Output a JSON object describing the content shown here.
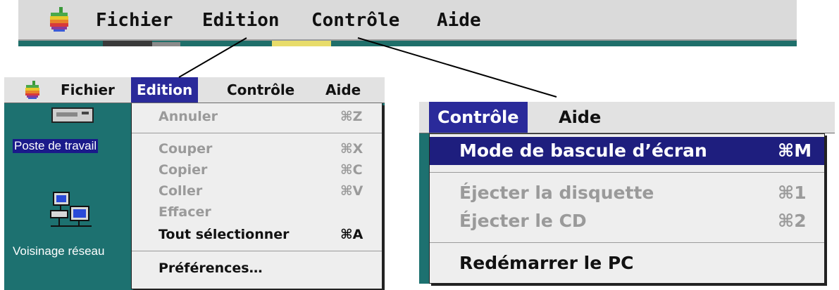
{
  "top_menubar": {
    "apple_icon": "apple-rainbow-icon",
    "items": [
      "Fichier",
      "Edition",
      "Contrôle",
      "Aide"
    ]
  },
  "edition_panel": {
    "menubar_items": [
      "Fichier",
      "Edition",
      "Contrôle",
      "Aide"
    ],
    "active_menu": "Edition",
    "menu_items": [
      {
        "label": "Annuler",
        "shortcut": "⌘Z",
        "enabled": false
      },
      {
        "label": "Couper",
        "shortcut": "⌘X",
        "enabled": false
      },
      {
        "label": "Copier",
        "shortcut": "⌘C",
        "enabled": false
      },
      {
        "label": "Coller",
        "shortcut": "⌘V",
        "enabled": false
      },
      {
        "label": "Effacer",
        "shortcut": "",
        "enabled": false
      },
      {
        "label": "Tout sélectionner",
        "shortcut": "⌘A",
        "enabled": true
      },
      {
        "label": "Préférences…",
        "shortcut": "",
        "enabled": true
      }
    ],
    "desktop_icons": [
      {
        "label": "Poste de travail",
        "icon": "computer-icon"
      },
      {
        "label": "Voisinage réseau",
        "icon": "network-neighborhood-icon"
      }
    ]
  },
  "controle_panel": {
    "menubar_items": [
      "Contrôle",
      "Aide"
    ],
    "active_menu": "Contrôle",
    "menu_items": [
      {
        "label": "Mode de bascule d’écran",
        "shortcut": "⌘M",
        "state": "highlighted"
      },
      {
        "label": "Éjecter la disquette",
        "shortcut": "⌘1",
        "state": "disabled"
      },
      {
        "label": "Éjecter le CD",
        "shortcut": "⌘2",
        "state": "disabled"
      },
      {
        "label": "Redémarrer le PC",
        "shortcut": "",
        "state": "enabled"
      }
    ]
  },
  "colors": {
    "menu_highlight": "#2a2a9a",
    "desktop_teal": "#1d7170",
    "disabled_text": "#9a9a9a"
  }
}
